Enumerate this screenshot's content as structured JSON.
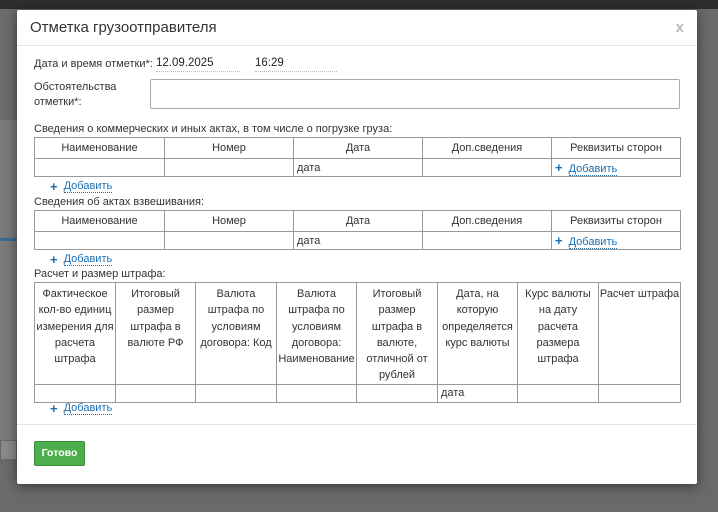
{
  "modal": {
    "title": "Отметка грузоотправителя",
    "close": "x"
  },
  "form": {
    "datetime_label": "Дата и время отметки*:",
    "date_value": "12.09.2025",
    "time_value": "16:29",
    "circumstances_label_line1": "Обстоятельства",
    "circumstances_label_line2": "отметки*:",
    "circumstances_value": ""
  },
  "section1": {
    "title": "Сведения о коммерческих и иных актах, в том числе о погрузке груза:",
    "columns": [
      "Наименование",
      "Номер",
      "Дата",
      "Доп.сведения",
      "Реквизиты сторон"
    ],
    "row": {
      "date_placeholder": "дата",
      "add": "Добавить"
    },
    "add_label": "Добавить"
  },
  "section2": {
    "title": "Сведения об актах взвешивания:",
    "columns": [
      "Наименование",
      "Номер",
      "Дата",
      "Доп.сведения",
      "Реквизиты сторон"
    ],
    "row": {
      "date_placeholder": "дата",
      "add": "Добавить"
    },
    "add_label": "Добавить"
  },
  "section3": {
    "title": "Расчет и размер штрафа:",
    "columns": [
      "Фактическое кол-во единиц измерения для расчета штрафа",
      "Итоговый размер штрафа в валюте РФ",
      "Валюта штрафа по условиям договора: Код",
      "Валюта штрафа по условиям договора: Наименование",
      "Итоговый размер штрафа в валюте, отличной от рублей",
      "Дата, на которую определяется курс валюты",
      "Курс валюты на дату расчета размера штрафа",
      "Расчет штрафа"
    ],
    "row": {
      "date_placeholder": "дата"
    },
    "add_label": "Добавить"
  },
  "footer": {
    "done_label": "Готово"
  },
  "colors": {
    "accent_link": "#1a6fb3",
    "done_button": "#4cae4c"
  }
}
